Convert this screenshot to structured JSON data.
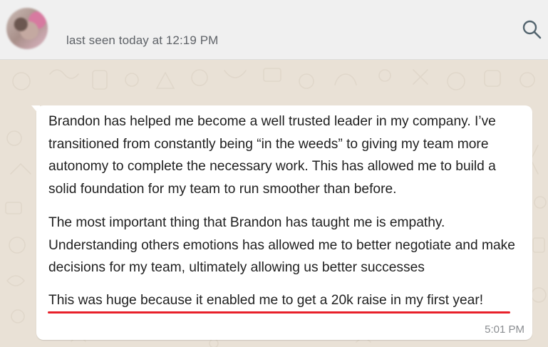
{
  "header": {
    "status": "last seen today at 12:19 PM"
  },
  "message": {
    "paragraphs": [
      "Brandon has helped me become a well trusted leader in my company. I’ve transitioned from constantly being “in the weeds” to giving my team more autonomy to complete the necessary work. This has allowed me to build a solid foundation for my team to run smoother than before.",
      "The most important thing that Brandon has taught me is empathy. Understanding others emotions has allowed me to better negotiate and make decisions for my team, ultimately allowing us better successes",
      "This was huge because it enabled me to get a 20k raise in my first year!"
    ],
    "time": "5:01 PM"
  },
  "colors": {
    "header_bg": "#f0f0f0",
    "chat_bg": "#e9e1d6",
    "bubble_bg": "#ffffff",
    "highlight_underline": "#e8202a"
  },
  "icons": {
    "search": "search-icon"
  }
}
